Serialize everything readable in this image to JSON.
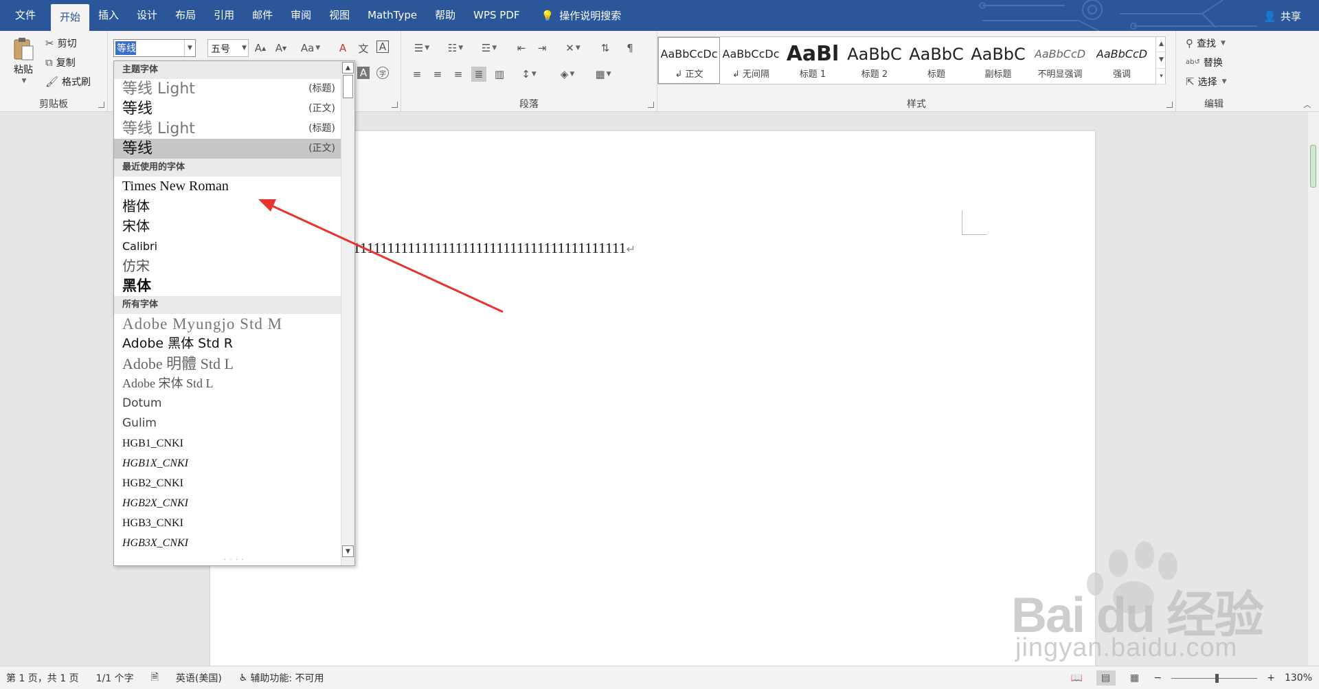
{
  "tabs": [
    {
      "label": "文件"
    },
    {
      "label": "开始"
    },
    {
      "label": "插入"
    },
    {
      "label": "设计"
    },
    {
      "label": "布局"
    },
    {
      "label": "引用"
    },
    {
      "label": "邮件"
    },
    {
      "label": "审阅"
    },
    {
      "label": "视图"
    },
    {
      "label": "MathType"
    },
    {
      "label": "帮助"
    },
    {
      "label": "WPS PDF"
    }
  ],
  "tell_me": "操作说明搜索",
  "share": "共享",
  "clipboard": {
    "paste": "粘贴",
    "cut": "剪切",
    "copy": "复制",
    "format_painter": "格式刷",
    "label": "剪贴板"
  },
  "font": {
    "name": "等线",
    "size": "五号"
  },
  "paragraph": {
    "label": "段落"
  },
  "styles": {
    "label": "样式",
    "items": [
      {
        "sample": "AaBbCcDc",
        "name": "↲ 正文"
      },
      {
        "sample": "AaBbCcDc",
        "name": "↲ 无间隔"
      },
      {
        "sample": "AaBl",
        "name": "标题 1"
      },
      {
        "sample": "AaBbC",
        "name": "标题 2"
      },
      {
        "sample": "AaBbC",
        "name": "标题"
      },
      {
        "sample": "AaBbC",
        "name": "副标题"
      },
      {
        "sample": "AaBbCcD",
        "name": "不明显强调"
      },
      {
        "sample": "AaBbCcD",
        "name": "强调"
      }
    ]
  },
  "editing": {
    "find": "查找",
    "replace": "替换",
    "select": "选择",
    "label": "编辑"
  },
  "document": {
    "text": "1111111111111111111111111111111111111111",
    "return_mark": "↵"
  },
  "font_dropdown": {
    "theme_header": "主题字体",
    "theme_fonts": [
      {
        "name": "等线 Light",
        "tag": "(标题)"
      },
      {
        "name": "等线",
        "tag": "(正文)"
      },
      {
        "name": "等线 Light",
        "tag": "(标题)"
      },
      {
        "name": "等线",
        "tag": "(正文)"
      }
    ],
    "recent_header": "最近使用的字体",
    "recent_fonts": [
      "Times New Roman",
      "楷体",
      "宋体",
      "Calibri",
      "仿宋",
      "黑体"
    ],
    "all_header": "所有字体",
    "all_fonts": [
      "Adobe Myungjo Std M",
      "Adobe 黑体 Std R",
      "Adobe 明體 Std L",
      "Adobe 宋体 Std L",
      "Dotum",
      "Gulim",
      "HGB1_CNKI",
      "HGB1X_CNKI",
      "HGB2_CNKI",
      "HGB2X_CNKI",
      "HGB3_CNKI",
      "HGB3X_CNKI"
    ]
  },
  "status": {
    "page": "第 1 页，共 1 页",
    "words": "1/1 个字",
    "language": "英语(美国)",
    "accessibility": "辅助功能: 不可用",
    "zoom": "130%"
  },
  "watermark": {
    "brand": "Bai du 经验",
    "url": "jingyan.baidu.com"
  },
  "colors": {
    "ribbon_blue": "#2b579a",
    "arrow_red": "#e8332e"
  }
}
